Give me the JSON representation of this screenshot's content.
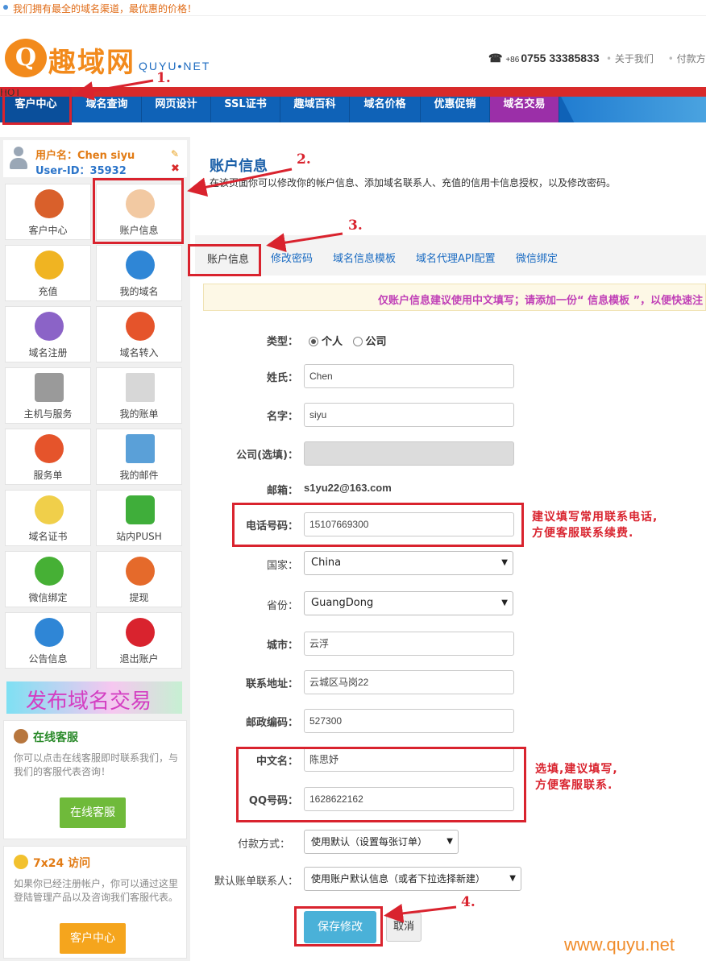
{
  "topbar": {
    "slogan": "我们拥有最全的域名渠道，最优惠的价格！"
  },
  "header": {
    "logo_mark": "Q",
    "logo_cn": "趣域网",
    "logo_en": "QUYU•NET",
    "phone_prefix": "+86",
    "phone": "0755 33385833",
    "links": [
      "关于我们",
      "付款方"
    ]
  },
  "nav": {
    "items": [
      "客户中心",
      "域名查询",
      "网页设计",
      "SSL证书",
      "趣域百科",
      "域名价格",
      "优惠促销",
      "域名交易"
    ],
    "hot_badge": "HOT"
  },
  "sidebar": {
    "user_label": "用户名：Chen siyu",
    "user_id": "User-ID：35932",
    "tiles": [
      "客户中心",
      "账户信息",
      "充值",
      "我的域名",
      "域名注册",
      "域名转入",
      "主机与服务",
      "我的账单",
      "服务单",
      "我的邮件",
      "域名证书",
      "站内PUSH",
      "微信绑定",
      "提现",
      "公告信息",
      "退出账户"
    ],
    "promo": "发布域名交易",
    "service": {
      "title": "在线客服",
      "desc": "你可以点击在线客服即时联系我们，与我们的客服代表咨询！",
      "button": "在线客服"
    },
    "visit": {
      "title": "7x24 访问",
      "desc": "如果你已经注册帐户，你可以通过这里登陆管理产品以及咨询我们客服代表。",
      "button": "客户中心"
    }
  },
  "main": {
    "title": "账户信息",
    "desc": "在该页面你可以修改你的帐户信息、添加域名联系人、充值的信用卡信息授权，以及修改密码。",
    "tabs": [
      "账户信息",
      "修改密码",
      "域名信息模板",
      "域名代理API配置",
      "微信绑定"
    ],
    "notice": "仅账户信息建议使用中文填写；请添加一份“ 信息模板 ”，以便快速注"
  },
  "form": {
    "type_label": "类型：",
    "type_personal": "个人",
    "type_company": "公司",
    "surname_label": "姓氏：",
    "surname": "Chen",
    "name_label": "名字：",
    "name": "siyu",
    "company_label": "公司(选填)：",
    "email_label": "邮箱：",
    "email": "s1yu22@163.com",
    "phone_label": "电话号码：",
    "phone": "15107669300",
    "country_label": "国家：",
    "country": "China",
    "province_label": "省份：",
    "province": "GuangDong",
    "city_label": "城市：",
    "city": "云浮",
    "address_label": "联系地址：",
    "address": "云城区马岗22",
    "zip_label": "邮政编码：",
    "zip": "527300",
    "cn_name_label": "中文名：",
    "cn_name": "陈思妤",
    "qq_label": "QQ号码：",
    "qq": "1628622162",
    "payment_label": "付款方式：",
    "payment": "使用默认（设置每张订单）",
    "billing_label": "默认账单联系人：",
    "billing": "使用账户默认信息（或者下拉选择新建）",
    "save": "保存修改",
    "cancel": "取消"
  },
  "annotations": {
    "n1": "1.",
    "n2": "2.",
    "n3": "3.",
    "n4": "4.",
    "phone_tip_1": "建议填写常用联系电话,",
    "phone_tip_2": "方便客服联系续费.",
    "optional_tip_1": "选填,建议填写,",
    "optional_tip_2": "方便客服联系."
  },
  "watermark": "www.quyu.net"
}
